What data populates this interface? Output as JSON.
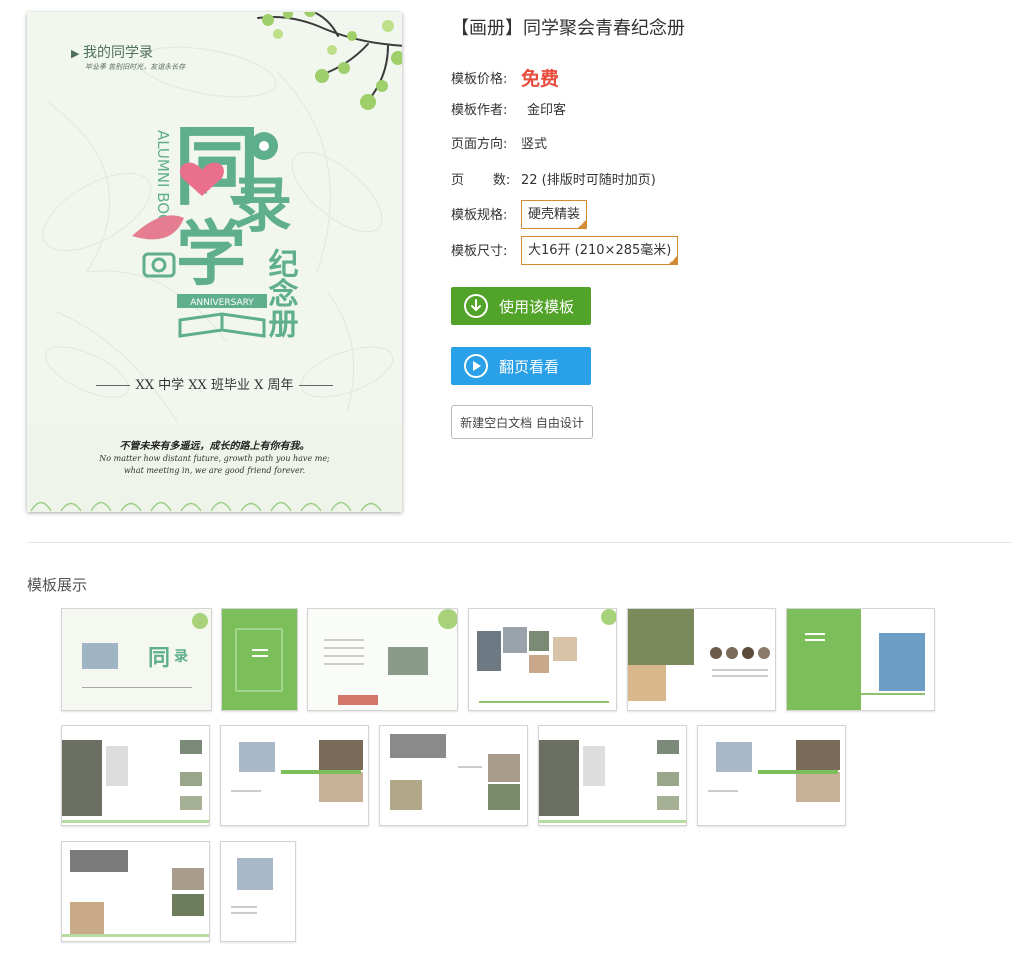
{
  "cover": {
    "tag": "我的同学录",
    "tag_sub": "毕业季 告别旧时光，友谊永长存",
    "logo_title_1": "同",
    "logo_title_2": "录",
    "logo_title_3": "学",
    "logo_sub": "纪念册",
    "logo_en": "ALUMNI BOOK",
    "logo_badge": "ANNIVERSARY",
    "motto": "XX 中学 XX 班毕业 X 周年",
    "quote_cn": "不管未来有多遥远，成长的路上有你有我。",
    "quote_en_1": "No matter how distant future, growth path you have me;",
    "quote_en_2": "what meeting in, we are good friend forever."
  },
  "info": {
    "title": "【画册】同学聚会青春纪念册",
    "price_label": "模板价格:",
    "price_value": "免费",
    "author_label": "模板作者:",
    "author_value": "金印客",
    "orientation_label": "页面方向:",
    "orientation_value": "竖式",
    "pages_label": "页       数:",
    "pages_value": "22 (排版时可随时加页)",
    "spec_label": "模板规格:",
    "spec_value": "硬壳精装",
    "size_label": "模板尺寸:",
    "size_value": "大16开 (210×285毫米)"
  },
  "buttons": {
    "use_label": "使用该模板",
    "flip_label": "翻页看看",
    "blank_label": "新建空白文档 自由设计"
  },
  "gallery": {
    "title": "模板展示"
  },
  "colors": {
    "accent_green": "#52a329",
    "accent_blue": "#2aa0e8",
    "price_red": "#e84c3d",
    "option_border": "#d38a35",
    "cover_green": "#5fae8d"
  }
}
